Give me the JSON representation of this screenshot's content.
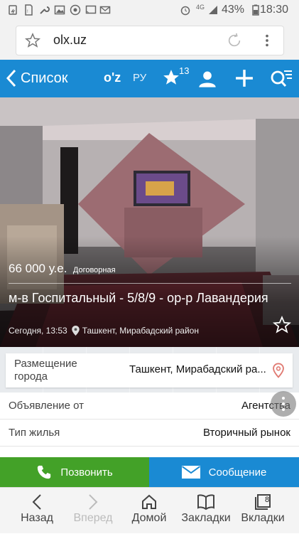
{
  "status_bar": {
    "signal": "4G",
    "battery": "43%",
    "time": "18:30"
  },
  "browser": {
    "url": "olx.uz"
  },
  "appbar": {
    "back_label": "Список",
    "lang_uz": "O'Z",
    "lang_ru": "РУ",
    "favorites_count": "13"
  },
  "listing": {
    "price": "66 000 у.е.",
    "price_note": "Договорная",
    "title": "м-в Госпитальный - 5/8/9 - ор-р Лавандерия",
    "date": "Сегодня, 13:53",
    "location": "Ташкент, Мирабадский район"
  },
  "details": {
    "city_label": "Размещение города",
    "city_value": "Ташкент, Мирабадский ра...",
    "rows": [
      {
        "label": "Объявление от",
        "value": "Агентства"
      },
      {
        "label": "Тип жилья",
        "value": "Вторичный рынок"
      }
    ]
  },
  "actions": {
    "call_label": "Позвонить",
    "message_label": "Сообщение",
    "call_color": "#43a128",
    "message_color": "#1a8ad3"
  },
  "bottom_nav": {
    "back": "Назад",
    "forward": "Вперед",
    "home": "Домой",
    "bookmarks": "Закладки",
    "tabs": "Вкладки",
    "tabs_count": "8"
  }
}
